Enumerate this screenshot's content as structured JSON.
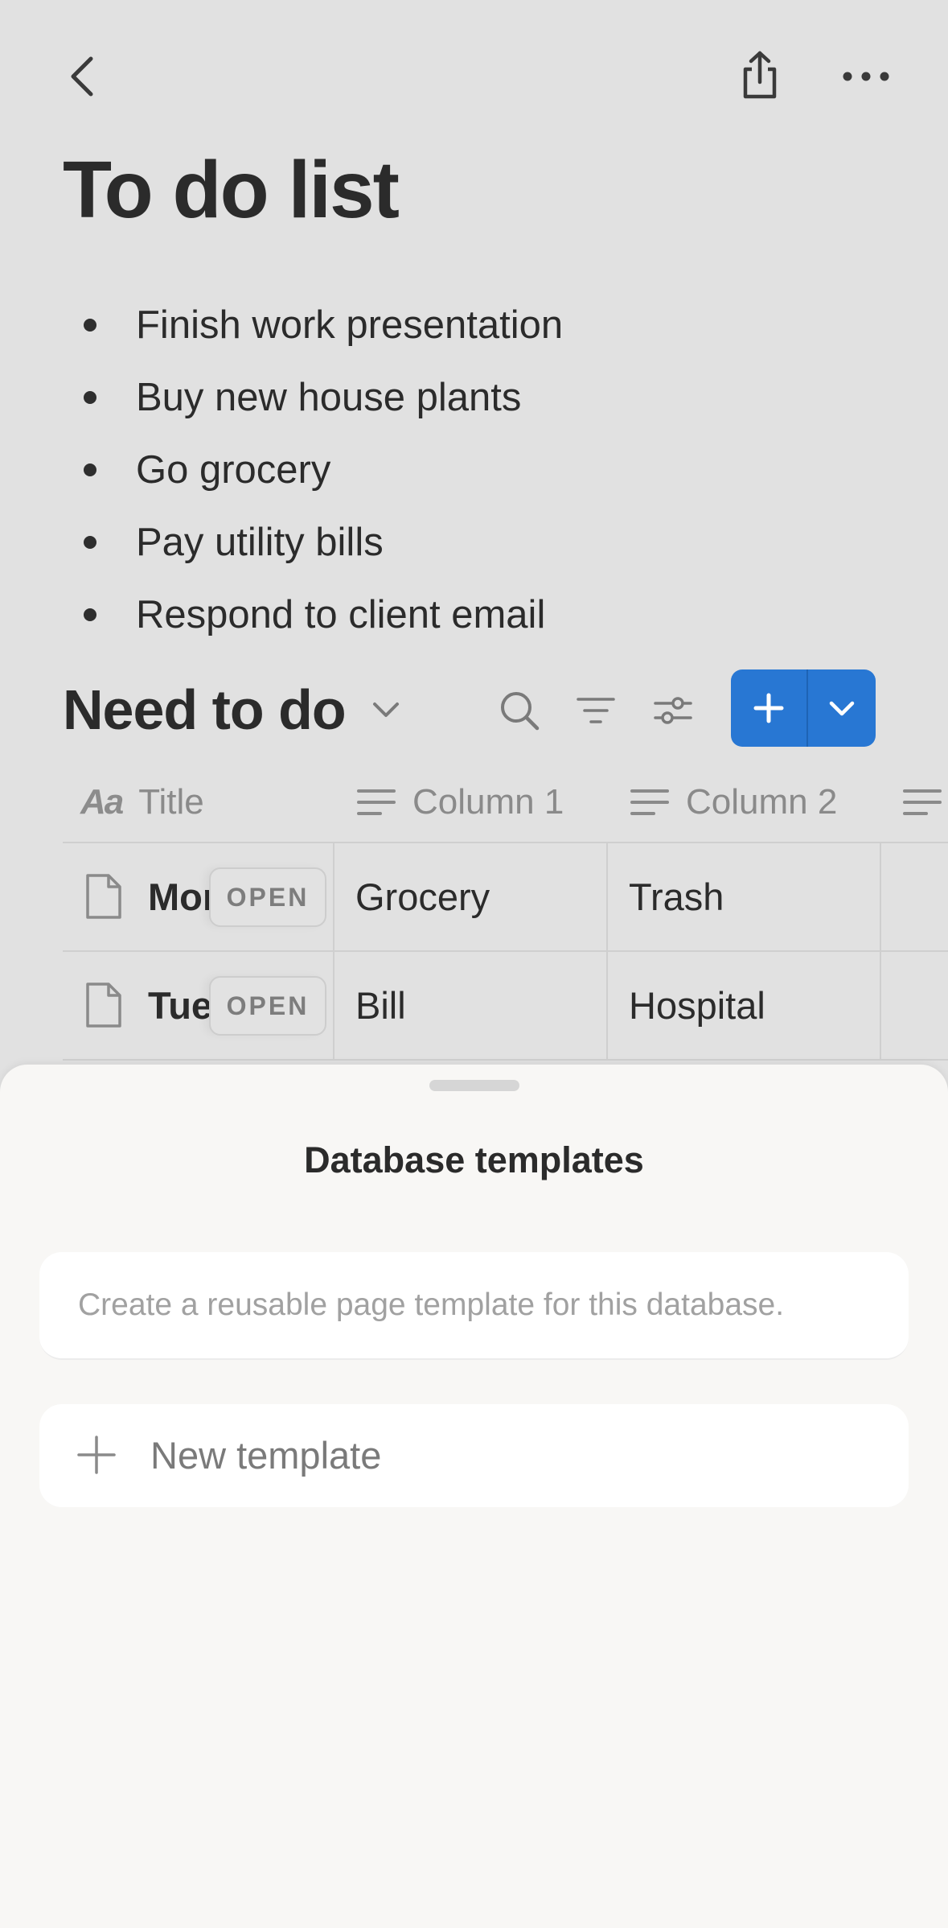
{
  "header": {
    "back_icon": "chevron-left-icon",
    "share_icon": "share-icon",
    "more_icon": "more-horizontal-icon"
  },
  "page": {
    "title": "To do list",
    "bullets": [
      "Finish work presentation",
      "Buy new house plants",
      "Go grocery",
      "Pay utility bills",
      "Respond to client email"
    ]
  },
  "database": {
    "title": "Need to do",
    "columns": [
      "Title",
      "Column 1",
      "Column 2"
    ],
    "rows": [
      {
        "title": "Mon",
        "open_label": "OPEN",
        "col1": "Grocery",
        "col2": "Trash"
      },
      {
        "title": "Tue",
        "open_label": "OPEN",
        "col1": "Bill",
        "col2": "Hospital"
      }
    ],
    "accent_color": "#2877d3"
  },
  "sheet": {
    "title": "Database templates",
    "description": "Create a reusable page template for this database.",
    "new_template_label": "New template"
  }
}
